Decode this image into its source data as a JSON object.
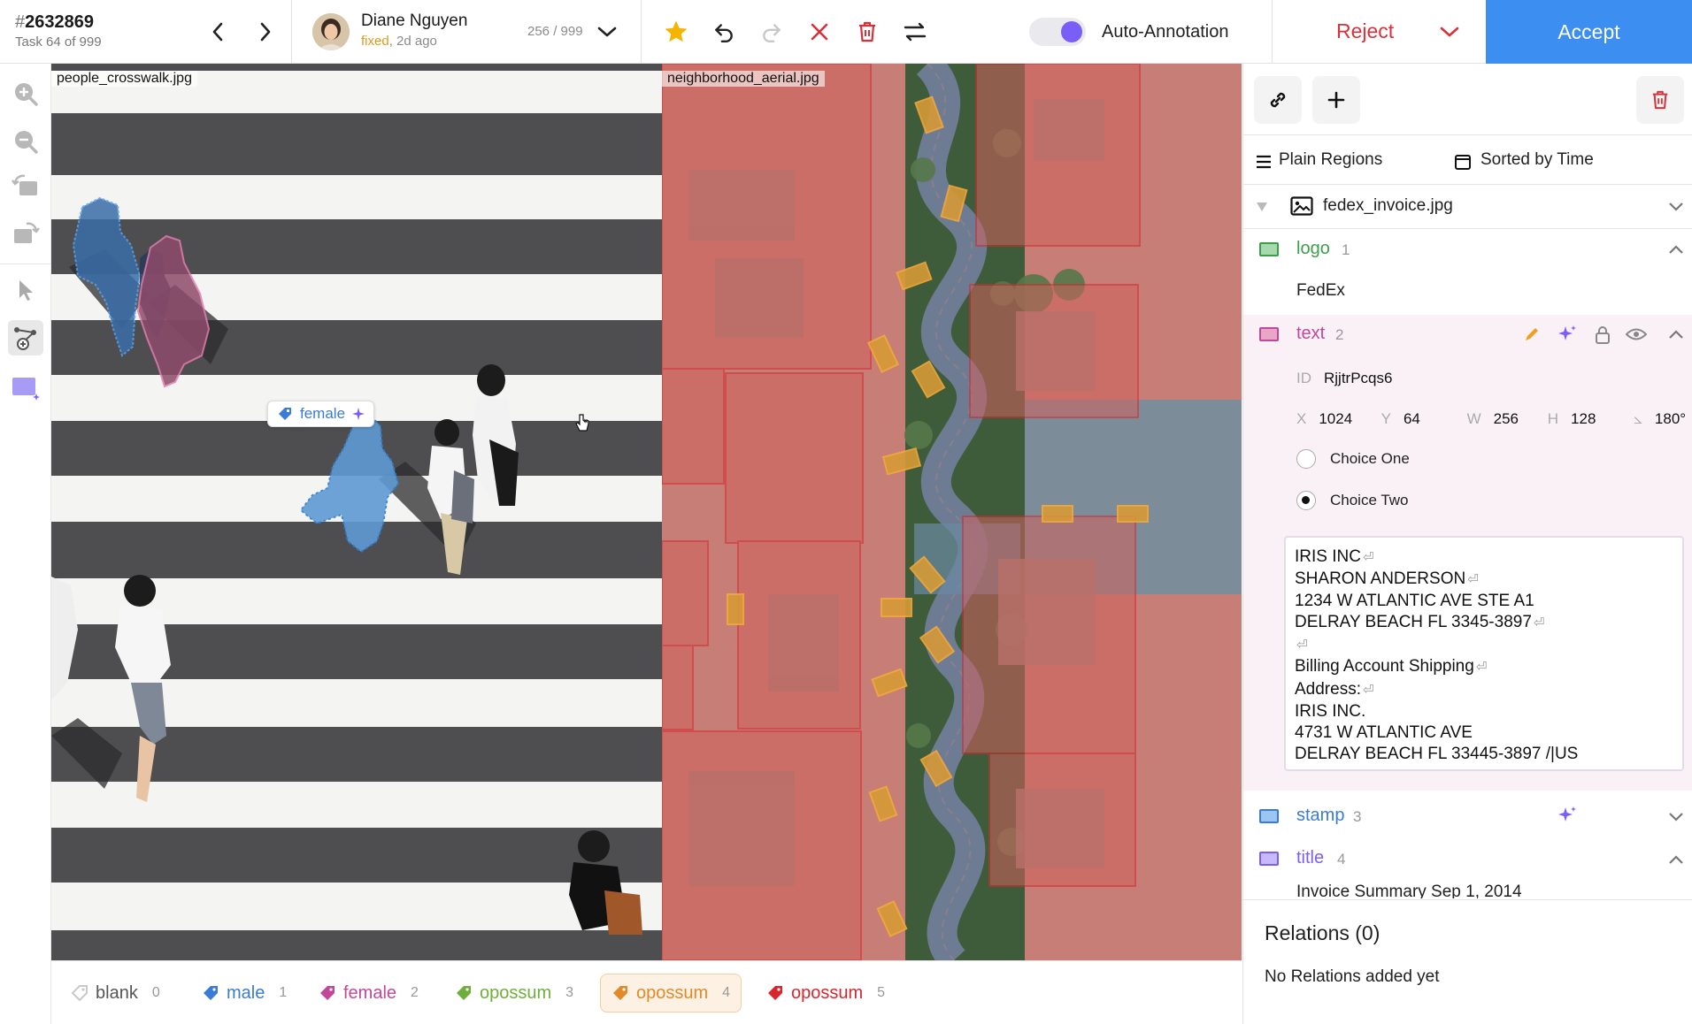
{
  "task": {
    "hash": "#",
    "id": "2632869",
    "count": "Task 64 of 999"
  },
  "user": {
    "name": "Diane Nguyen",
    "status_fixed": "fixed",
    "status_ago": ", 2d ago",
    "counter": "256 / 999"
  },
  "auto_annotation": {
    "label": "Auto-Annotation",
    "enabled": true
  },
  "actions": {
    "reject": "Reject",
    "accept": "Accept"
  },
  "canvas": {
    "image1_caption": "people_crosswalk.jpg",
    "image2_caption": "neighborhood_aerial.jpg",
    "region_tag": "female"
  },
  "labels": [
    {
      "name": "blank",
      "hotkey": "0",
      "color": "#9a9a9a"
    },
    {
      "name": "male",
      "hotkey": "1",
      "color": "#3a7bd5"
    },
    {
      "name": "female",
      "hotkey": "2",
      "color": "#c2479b"
    },
    {
      "name": "opossum",
      "hotkey": "3",
      "color": "#6fae3a"
    },
    {
      "name": "opossum",
      "hotkey": "4",
      "color": "#e08a2a",
      "selected": true
    },
    {
      "name": "opossum",
      "hotkey": "5",
      "color": "#d7262e"
    }
  ],
  "panel": {
    "view_mode": "Plain Regions",
    "sort_mode": "Sorted by Time",
    "file": "fedex_invoice.jpg",
    "regions": [
      {
        "name": "logo",
        "num": "1",
        "color": "#3c9e4a",
        "swatch": "#a7d9ae",
        "value": "FedEx"
      },
      {
        "name": "text",
        "num": "2",
        "color": "#c2479b",
        "swatch": "#eaa6c6",
        "id_label": "ID",
        "id": "RjjtrPcqs6",
        "x_label": "X",
        "x": "1024",
        "y_label": "Y",
        "y": "64",
        "w_label": "W",
        "w": "256",
        "h_label": "H",
        "h": "128",
        "angle": "180°",
        "choices": [
          "Choice One",
          "Choice Two"
        ],
        "selected_choice": "Choice Two",
        "lines": [
          "IRIS INC",
          "SHARON ANDERSON",
          "1234 W ATLANTIC AVE STE A1",
          "DELRAY BEACH FL 3345-3897",
          "",
          "Billing Account Shipping",
          "Address:",
          "IRIS INC.",
          "4731 W ATLANTIC AVE",
          "DELRAY BEACH FL 33445-3897 /|US"
        ]
      },
      {
        "name": "stamp",
        "num": "3",
        "color": "#3a7bd5",
        "swatch": "#9cc6f2"
      },
      {
        "name": "title",
        "num": "4",
        "color": "#7a5ef8",
        "swatch": "#c7b9fb",
        "value": "Invoice Summary Sep 1, 2014"
      }
    ],
    "relations_title": "Relations (0)",
    "relations_empty": "No Relations added yet"
  },
  "colors": {
    "accent": "#3c8ef0",
    "reject": "#d9313a",
    "toggle": "#7a5ef8",
    "star": "#f5b400"
  }
}
